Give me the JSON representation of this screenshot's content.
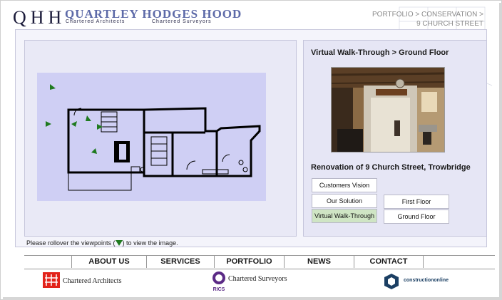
{
  "header": {
    "mark": "QHH",
    "brand": "QUARTLEY HODGES HOOD",
    "sub_architects": "Chartered Architects",
    "sub_surveyors": "Chartered Surveyors",
    "breadcrumb": {
      "portfolio": "PORTFOLIO",
      "sep1": " > ",
      "conservation": "CONSERVATION",
      "sep2": " >",
      "current": "9 CHURCH STREET"
    }
  },
  "main": {
    "rollover_before": "Please rollover the viewpoints (",
    "rollover_after": ") to view the image.",
    "side_title": "Virtual Walk-Through > Ground Floor",
    "project_title": "Renovation of 9 Church Street, Trowbridge",
    "left_buttons": [
      "Customers Vision",
      "Our Solution",
      "Virtual Walk-Through"
    ],
    "right_buttons": [
      "First Floor",
      "Ground Floor"
    ]
  },
  "nav": [
    "ABOUT US",
    "SERVICES",
    "PORTFOLIO",
    "NEWS",
    "CONTACT"
  ],
  "footer": {
    "architects": "Chartered Architects",
    "surveyors": "Chartered Surveyors",
    "rics": "RICS",
    "construction": "constructiononline"
  },
  "colors": {
    "brand_blue": "#5d6aa8",
    "plan_bg": "#cfcff4",
    "active_button": "#cfe5c4",
    "viewpoint_green": "#1f7a1f"
  }
}
